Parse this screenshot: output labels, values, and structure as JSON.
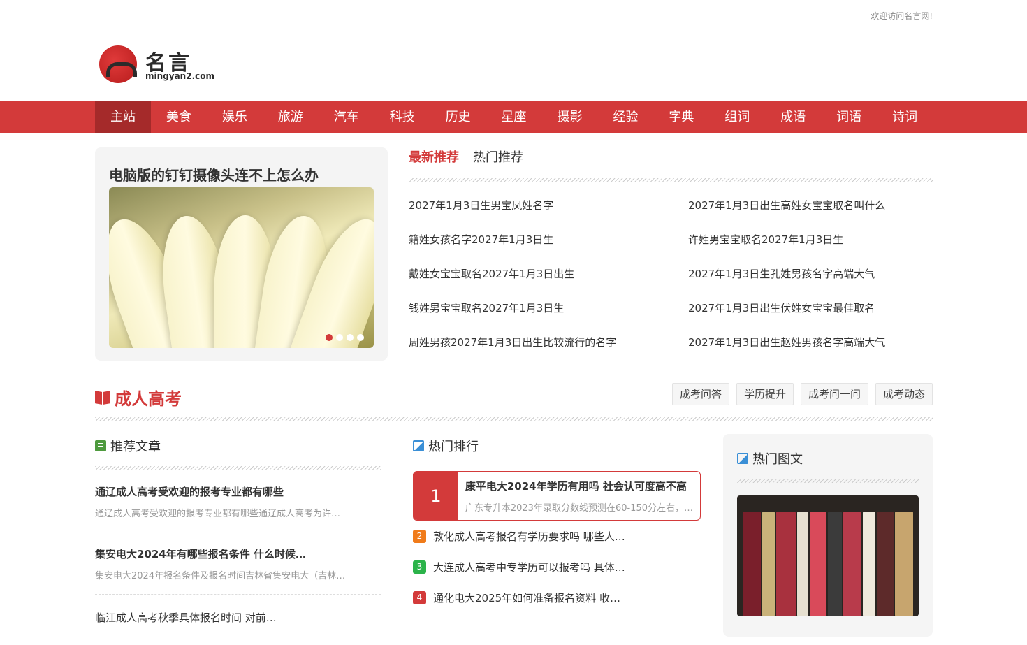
{
  "topbar": {
    "welcome": "欢迎访问名言网!"
  },
  "logo": {
    "name": "名言",
    "domain": "mingyan2.com"
  },
  "nav": [
    "主站",
    "美食",
    "娱乐",
    "旅游",
    "汽车",
    "科技",
    "历史",
    "星座",
    "摄影",
    "经验",
    "字典",
    "组词",
    "成语",
    "词语",
    "诗词"
  ],
  "feature": {
    "title": "电脑版的钉钉摄像头连不上怎么办"
  },
  "recs": {
    "tab_latest": "最新推荐",
    "tab_hot": "热门推荐",
    "items": [
      "2027年1月3日生男宝凤姓名字",
      "2027年1月3日出生高姓女宝宝取名叫什么",
      "籍姓女孩名字2027年1月3日生",
      "许姓男宝宝取名2027年1月3日生",
      "戴姓女宝宝取名2027年1月3日出生",
      "2027年1月3日生孔姓男孩名字高端大气",
      "钱姓男宝宝取名2027年1月3日生",
      "2027年1月3日出生伏姓女宝宝最佳取名",
      "周姓男孩2027年1月3日出生比较流行的名字",
      "2027年1月3日出生赵姓男孩名字高端大气"
    ]
  },
  "section": {
    "title": "成人高考",
    "buttons": [
      "成考问答",
      "学历提升",
      "成考问一问",
      "成考动态"
    ]
  },
  "col1": {
    "title": "推荐文章",
    "articles": [
      {
        "title": "通辽成人高考受欢迎的报考专业都有哪些",
        "desc": "通辽成人高考受欢迎的报考专业都有哪些通辽成人高考为许…"
      },
      {
        "title": "集安电大2024年有哪些报名条件 什么时候…",
        "desc": "集安电大2024年报名条件及报名时间吉林省集安电大（吉林…"
      },
      {
        "title": "临江成人高考秋季具体报名时间 对前…"
      }
    ]
  },
  "col2": {
    "title": "热门排行",
    "top": {
      "num": "1",
      "title": "康平电大2024年学历有用吗 社会认可度高不高",
      "desc": "广东专升本2023年录取分数线预测在60-150分左右，…"
    },
    "items": [
      {
        "num": "2",
        "title": "敦化成人高考报名有学历要求吗 哪些人…",
        "color": "#f07b1a"
      },
      {
        "num": "3",
        "title": "大连成人高考中专学历可以报考吗 具体…",
        "color": "#2bb34a"
      },
      {
        "num": "4",
        "title": "通化电大2025年如何准备报名资料 收…",
        "color": "#d33a3a"
      }
    ]
  },
  "col3": {
    "title": "热门图文"
  },
  "colors": {
    "accent": "#d33a3a",
    "nav_active": "#a52a2a"
  }
}
